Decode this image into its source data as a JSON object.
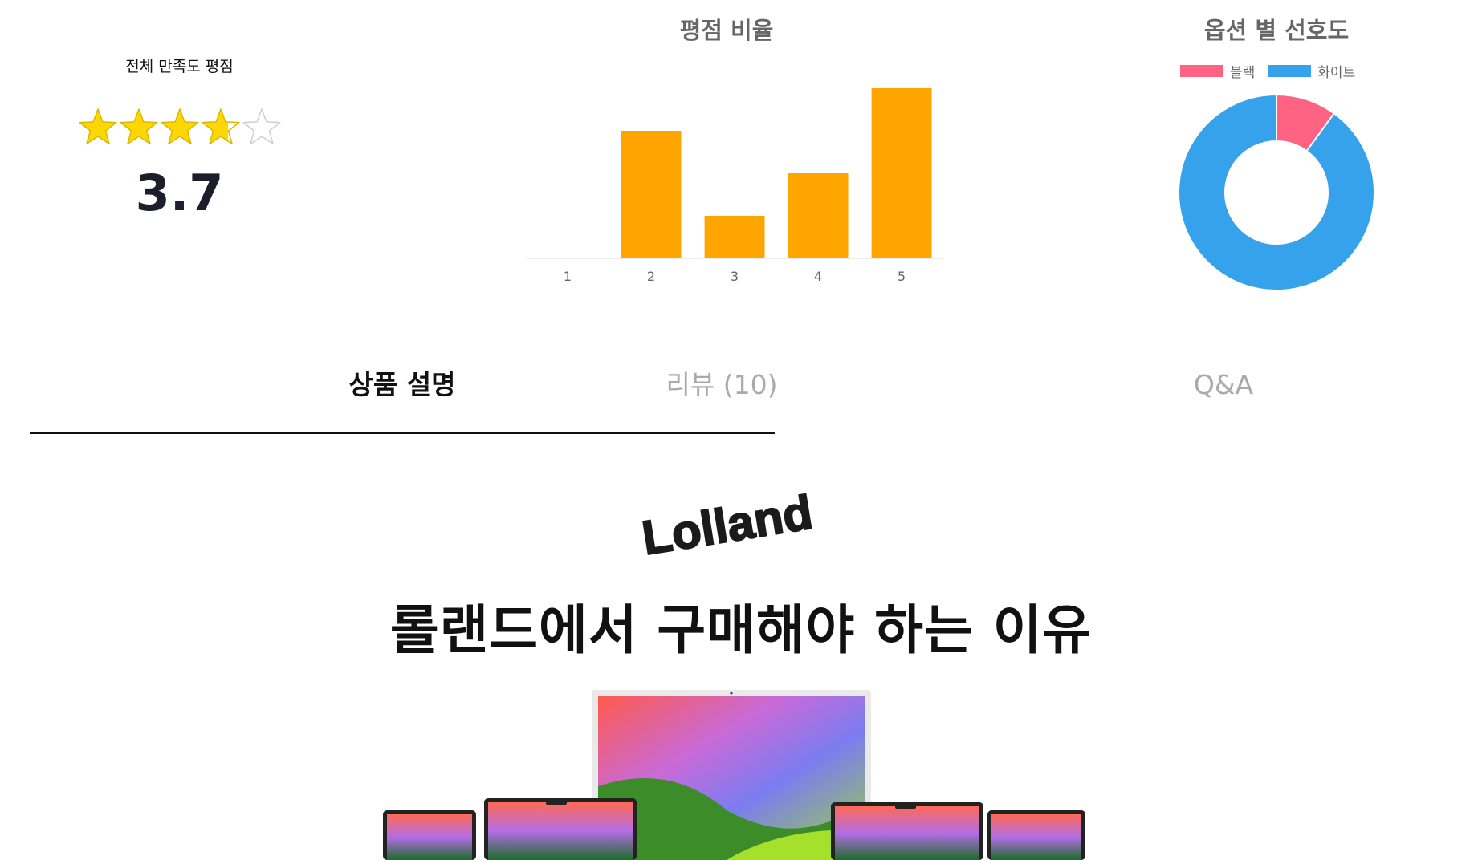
{
  "satisfaction": {
    "label": "전체 만족도 평점",
    "score": "3.7",
    "rating": 3.7,
    "max_stars": 5,
    "star_color": "#FFD700"
  },
  "rating_chart": {
    "title": "평점 비율",
    "chart_data": {
      "type": "bar",
      "categories": [
        "1",
        "2",
        "3",
        "4",
        "5"
      ],
      "values": [
        0,
        3,
        1,
        2,
        4
      ],
      "ylim": [
        0,
        4
      ],
      "color": "#FFA500",
      "grid": false
    }
  },
  "option_chart": {
    "title": "옵션 별 선호도",
    "chart_data": {
      "type": "pie",
      "labels": [
        "블랙",
        "화이트"
      ],
      "values": [
        1,
        9
      ],
      "colors": [
        "#FF6384",
        "#36A2EB"
      ],
      "legend": "top"
    }
  },
  "tabs": [
    {
      "label": "상품 설명",
      "active": true
    },
    {
      "label": "리뷰 (10)",
      "active": false
    },
    {
      "label": "Q&A",
      "active": false
    }
  ],
  "content": {
    "logo_text": "Lolland",
    "headline": "롤랜드에서 구매해야 하는 이유"
  }
}
